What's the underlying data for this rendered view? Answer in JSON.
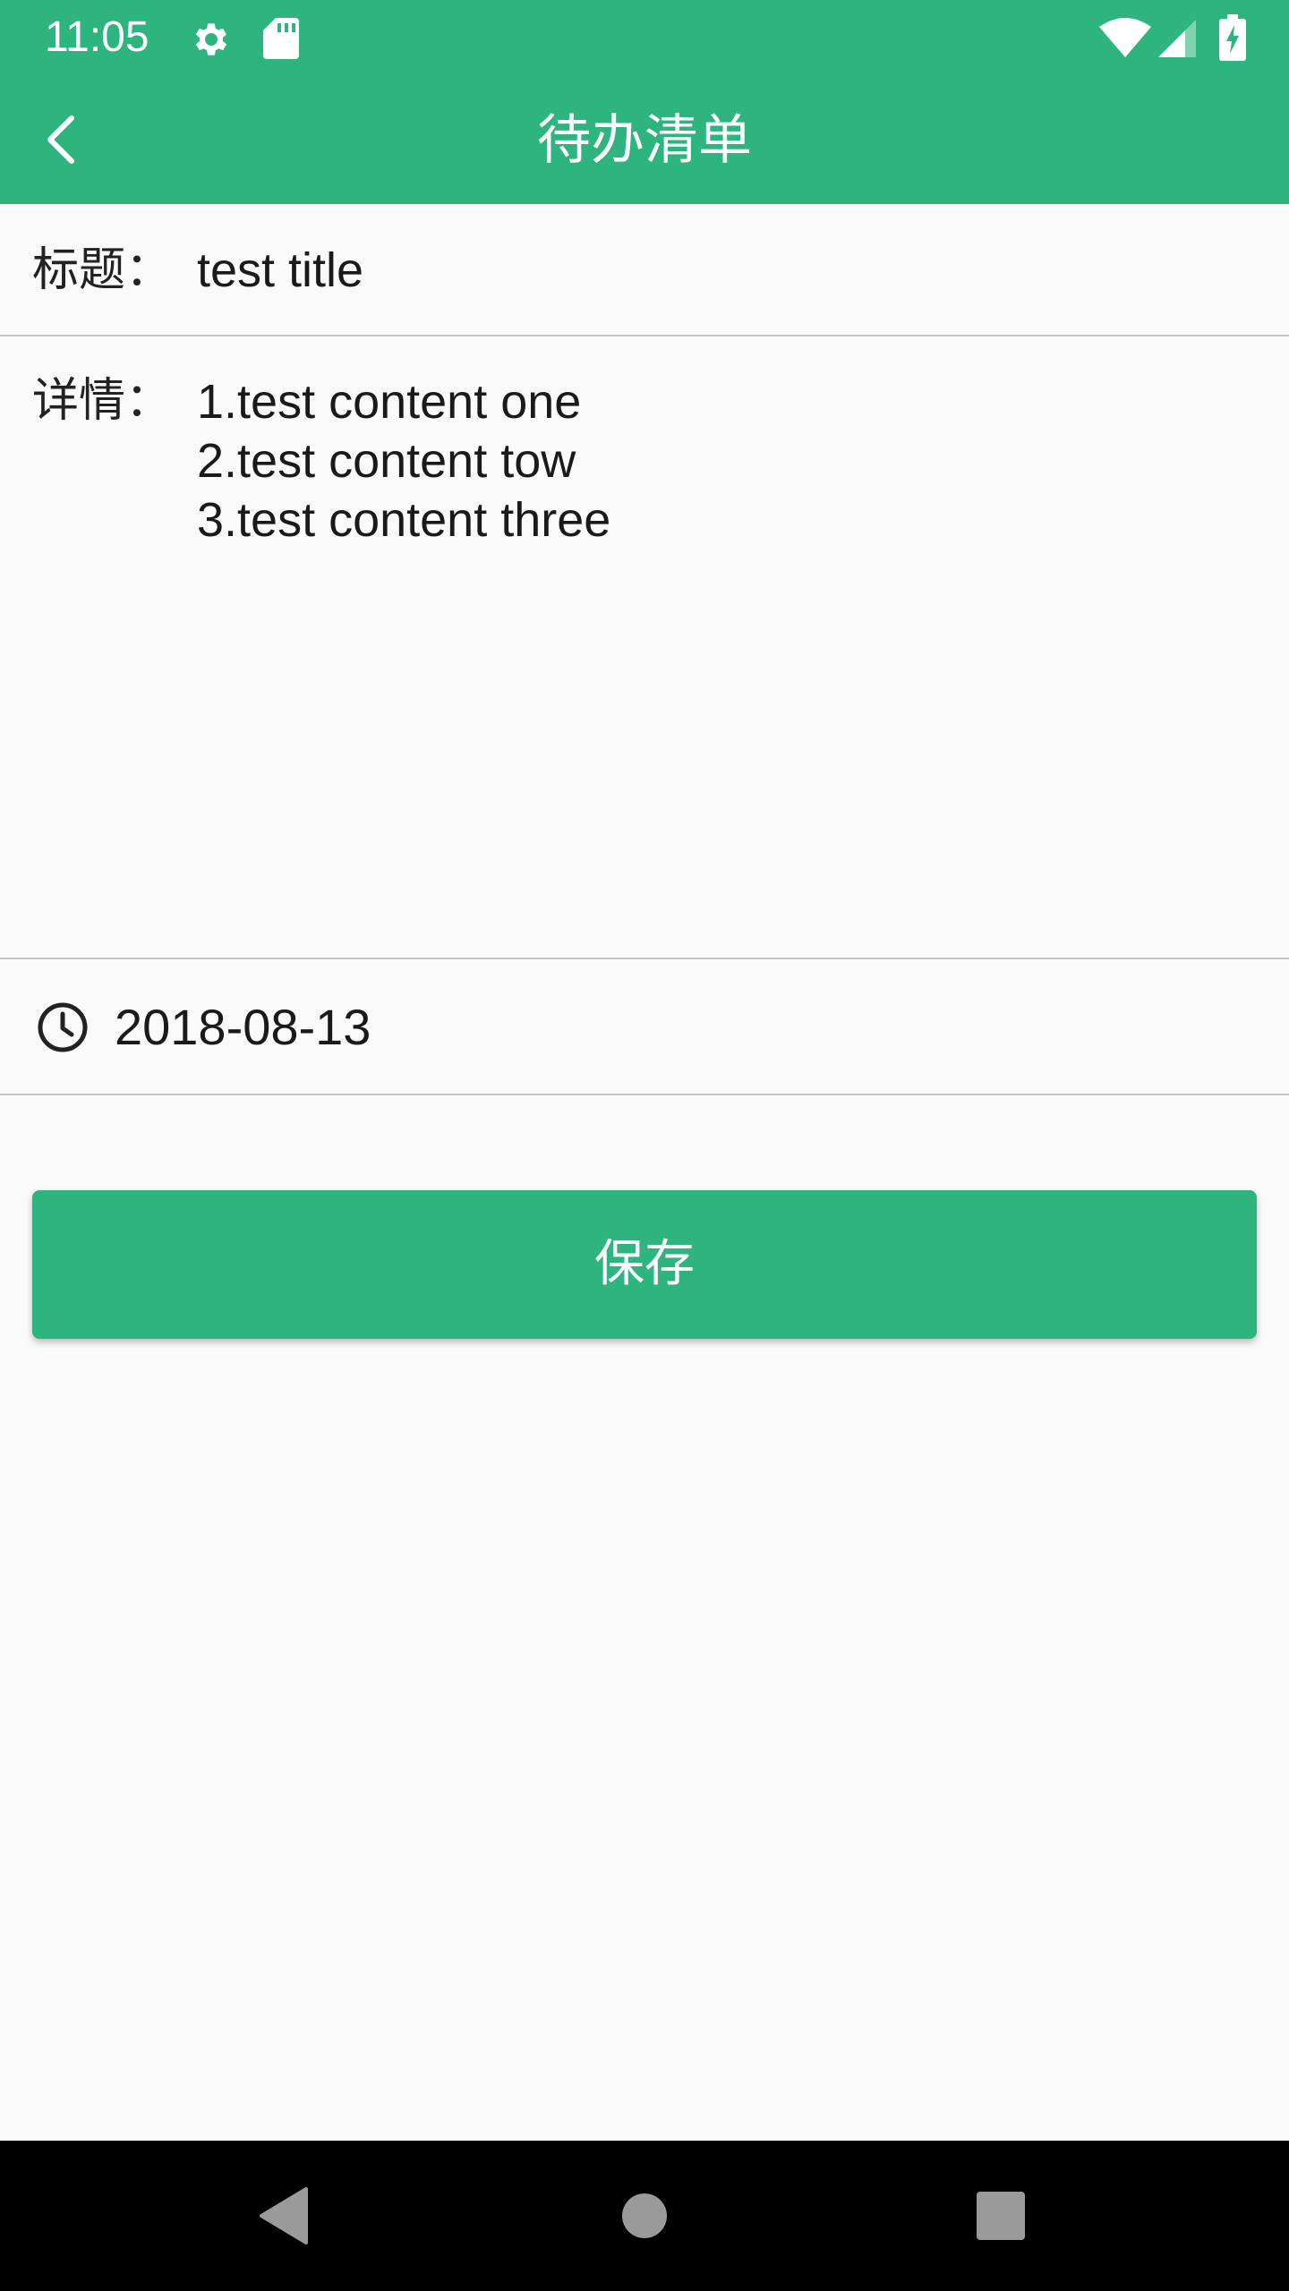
{
  "status_bar": {
    "time": "11:05",
    "icons": [
      "gear-icon",
      "sd-card-icon",
      "wifi-icon",
      "cell-signal-icon",
      "battery-charging-icon"
    ]
  },
  "toolbar": {
    "back_icon": "chevron-left-icon",
    "title": "待办清单"
  },
  "form": {
    "title_label": "标题：",
    "title_value": "test title",
    "detail_label": "详情：",
    "detail_lines": [
      "1.test content one",
      "2.test content tow",
      "3.test content three"
    ],
    "date_icon": "clock-icon",
    "date_value": "2018-08-13"
  },
  "save_button": {
    "label": "保存"
  },
  "nav_bar": {
    "buttons": [
      "back-triangle-icon",
      "home-circle-icon",
      "recents-square-icon"
    ]
  },
  "colors": {
    "accent": "#2db47f",
    "background": "#fafafa",
    "divider": "#c4c4c4",
    "nav_bar": "#000000"
  }
}
